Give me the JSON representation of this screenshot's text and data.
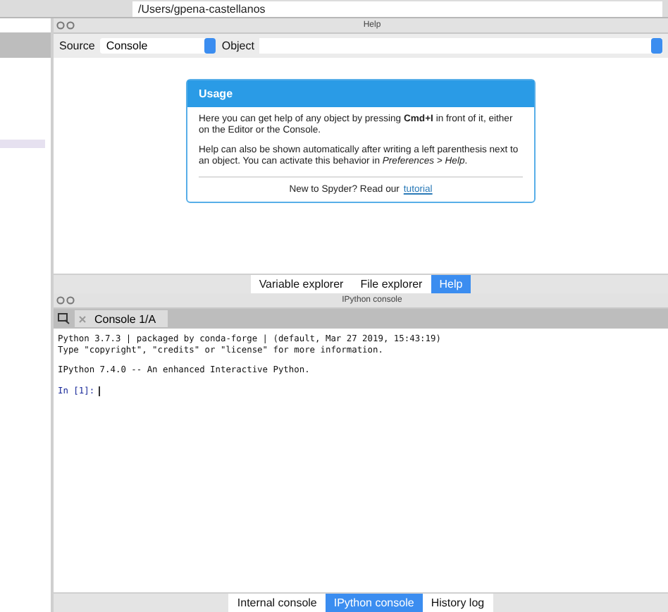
{
  "toolbar": {
    "path": "/Users/gpena-castellanos"
  },
  "help": {
    "title": "Help",
    "source_label": "Source",
    "source_value": "Console",
    "object_label": "Object",
    "usage": {
      "title": "Usage",
      "paragraphs": [
        "Here you can get help of any object by pressing **Cmd+I** in front of it, either on the Editor or the Console.",
        "Help can also be shown automatically after writing a left parenthesis next to an object. You can activate this behavior in *Preferences > Help*."
      ],
      "footer": "New to Spyder? Read our",
      "link": "tutorial"
    },
    "tabs": [
      {
        "label": "Variable explorer",
        "selected": false
      },
      {
        "label": "File explorer",
        "selected": false
      },
      {
        "label": "Help",
        "selected": true
      }
    ]
  },
  "console": {
    "title": "IPython console",
    "tab": "Console 1/A",
    "blocks": [
      [
        "Python 3.7.3 | packaged by conda-forge | (default, Mar 27 2019, 15:43:19)",
        "Type \"copyright\", \"credits\" or \"license\" for more information."
      ],
      [
        "IPython 7.4.0 -- An enhanced Interactive Python."
      ]
    ],
    "prompt": "In [1]:",
    "tabs": [
      {
        "label": "Internal console",
        "selected": false
      },
      {
        "label": "IPython console",
        "selected": true
      },
      {
        "label": "History log",
        "selected": false
      }
    ]
  }
}
